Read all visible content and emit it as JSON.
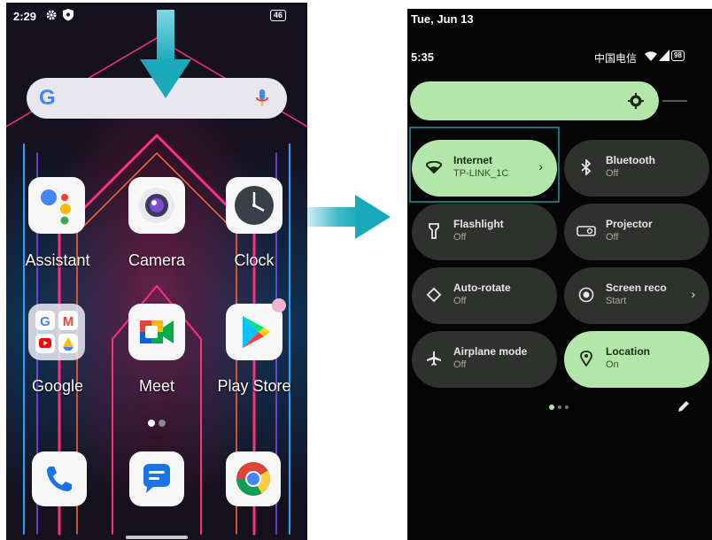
{
  "left_phone": {
    "status": {
      "time": "2:29",
      "battery": "46"
    },
    "search": {
      "logo": "G"
    },
    "apps_row1": [
      {
        "label": "Assistant",
        "icon": "assistant-icon"
      },
      {
        "label": "Camera",
        "icon": "camera-icon"
      },
      {
        "label": "Clock",
        "icon": "clock-icon"
      }
    ],
    "apps_row2": [
      {
        "label": "Google",
        "icon": "google-folder-icon"
      },
      {
        "label": "Meet",
        "icon": "meet-icon"
      },
      {
        "label": "Play Store",
        "icon": "play-store-icon"
      }
    ],
    "dock": [
      {
        "icon": "phone-icon"
      },
      {
        "icon": "messages-icon"
      },
      {
        "icon": "chrome-icon"
      }
    ]
  },
  "right_phone": {
    "date": "Tue, Jun 13",
    "time": "5:35",
    "carrier": "中国电信",
    "battery": "98",
    "tiles": [
      {
        "title": "Internet",
        "subtitle": "TP-LINK_1C",
        "state": "on",
        "icon": "wifi-icon",
        "chevron": true
      },
      {
        "title": "Bluetooth",
        "subtitle": "Off",
        "state": "off",
        "icon": "bluetooth-icon",
        "chevron": false
      },
      {
        "title": "Flashlight",
        "subtitle": "Off",
        "state": "off",
        "icon": "flashlight-icon",
        "chevron": false
      },
      {
        "title": "Projector",
        "subtitle": "Off",
        "state": "off",
        "icon": "projector-icon",
        "chevron": false
      },
      {
        "title": "Auto-rotate",
        "subtitle": "Off",
        "state": "off",
        "icon": "auto-rotate-icon",
        "chevron": false
      },
      {
        "title": "Screen reco",
        "subtitle": "Start",
        "state": "off",
        "icon": "screen-record-icon",
        "chevron": true
      },
      {
        "title": "Airplane mode",
        "subtitle": "Off",
        "state": "off",
        "icon": "airplane-icon",
        "chevron": false
      },
      {
        "title": "Location",
        "subtitle": "On",
        "state": "on",
        "icon": "location-icon",
        "chevron": false
      }
    ]
  },
  "colors": {
    "arrow": "#22b3c5",
    "tile_on": "#b3e6a9",
    "tile_off": "#2f312e",
    "highlight": "#1f6f77"
  }
}
